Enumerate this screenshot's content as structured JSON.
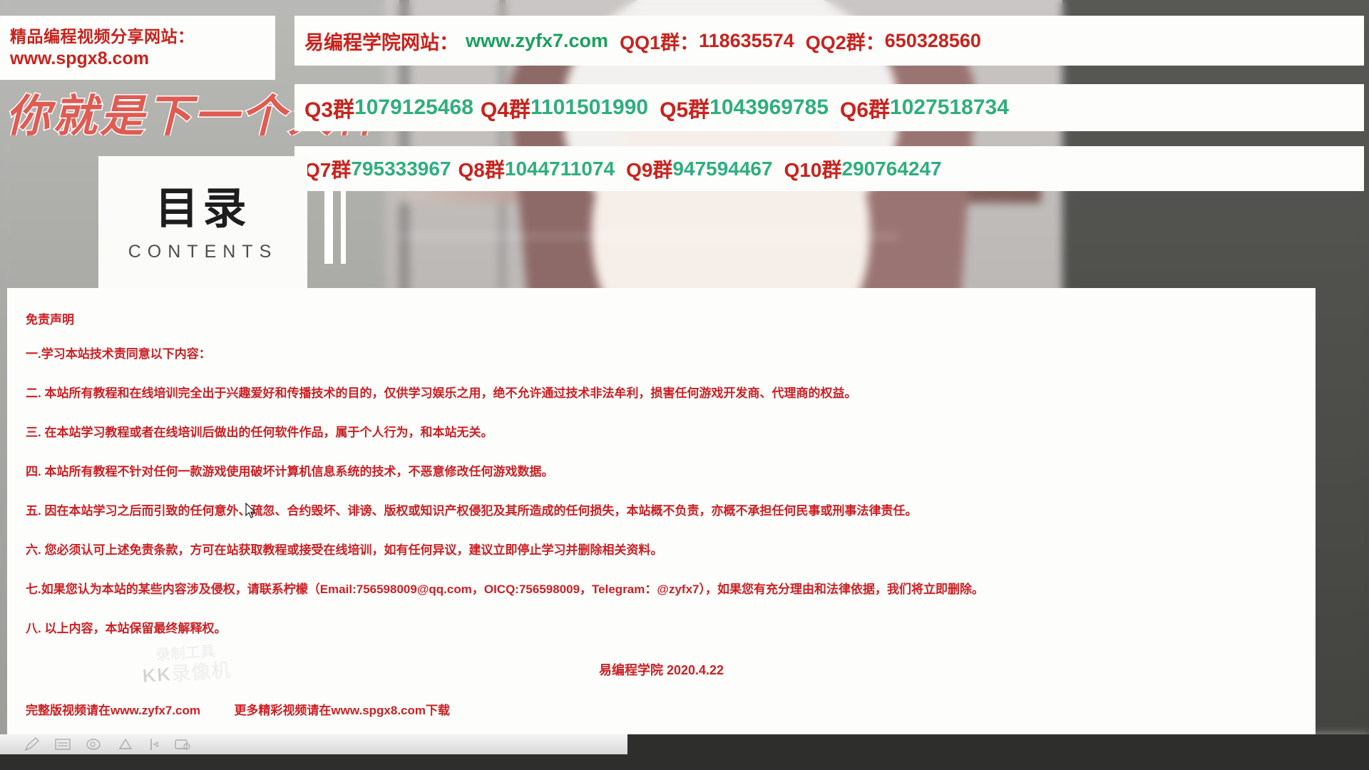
{
  "promo_left": {
    "line1": "精品编程视频分享网站：",
    "line2": "www.spgx8.com"
  },
  "headline": "你就是下一个大神",
  "contents": {
    "cn": "目录",
    "en": "CONTENTS"
  },
  "promo_banner": {
    "row1": {
      "site_label": "易编程学院网站：",
      "site_url": "www.zyfx7.com",
      "qq1_label": "QQ1群：",
      "qq1_value": "118635574",
      "qq2_label": "QQ2群：",
      "qq2_value": "650328560"
    },
    "row2": [
      {
        "label": "Q3群",
        "value": "1079125468"
      },
      {
        "label": "Q4群",
        "value": "1101501990"
      },
      {
        "label": "Q5群",
        "value": "1043969785"
      },
      {
        "label": "Q6群",
        "value": "1027518734"
      }
    ],
    "row3": [
      {
        "label": "Q7群",
        "value": "795333967"
      },
      {
        "label": "Q8群",
        "value": "1044711074"
      },
      {
        "label": "Q9群",
        "value": "947594467"
      },
      {
        "label": "Q10群",
        "value": "290764247"
      }
    ]
  },
  "disclaimer": {
    "title": "免责声明",
    "items": [
      "一.学习本站技术责同意以下内容：",
      "二. 本站所有教程和在线培训完全出于兴趣爱好和传播技术的目的，仅供学习娱乐之用，绝不允许通过技术非法牟利，损害任何游戏开发商、代理商的权益。",
      "三. 在本站学习教程或者在线培训后做出的任何软件作品，属于个人行为，和本站无关。",
      "四. 本站所有教程不针对任何一款游戏使用破坏计算机信息系统的技术，不恶意修改任何游戏数据。",
      "五. 因在本站学习之后而引致的任何意外、疏忽、合约毁坏、诽谤、版权或知识产权侵犯及其所造成的任何损失，本站概不负责，亦概不承担任何民事或刑事法律责任。",
      "六. 您必须认可上述免责条款，方可在站获取教程或接受在线培训，如有任何异议，建议立即停止学习并删除相关资料。",
      "七.如果您认为本站的某些内容涉及侵权，请联系柠檬（Email:756598009@qq.com，OICQ:756598009，Telegram：@zyfx7），如果您有充分理由和法律依据，我们将立即删除。",
      "八. 以上内容，本站保留最终解释权。"
    ],
    "signature": "易编程学院 2020.4.22",
    "footer_left": "完整版视频请在www.zyfx7.com",
    "footer_right": "更多精彩视频请在www.spgx8.com下载"
  },
  "watermark": {
    "line1": "录制工具",
    "line2": "KK录像机"
  },
  "colors": {
    "red": "#cc2024",
    "green": "#2fae7e",
    "link_green": "#1aa05e",
    "headline_red": "#e05b52"
  }
}
